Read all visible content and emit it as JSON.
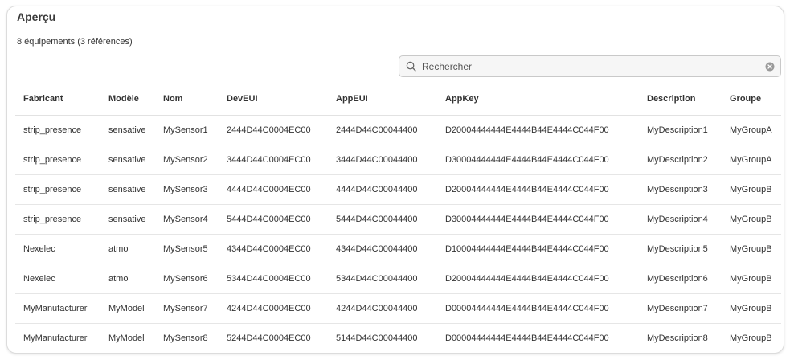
{
  "panel": {
    "title": "Aperçu",
    "summary": "8 équipements (3 références)"
  },
  "search": {
    "placeholder": "Rechercher",
    "value": "",
    "icon": "search-icon",
    "clear_icon": "clear-icon"
  },
  "table": {
    "columns": [
      "Fabricant",
      "Modèle",
      "Nom",
      "DevEUI",
      "AppEUI",
      "AppKey",
      "Description",
      "Groupe"
    ],
    "rows": [
      [
        "strip_presence",
        "sensative",
        "MySensor1",
        "2444D44C0004EC00",
        "2444D44C00044400",
        "D20004444444E4444B44E4444C044F00",
        "MyDescription1",
        "MyGroupA"
      ],
      [
        "strip_presence",
        "sensative",
        "MySensor2",
        "3444D44C0004EC00",
        "3444D44C00044400",
        "D30004444444E4444B44E4444C044F00",
        "MyDescription2",
        "MyGroupA"
      ],
      [
        "strip_presence",
        "sensative",
        "MySensor3",
        "4444D44C0004EC00",
        "4444D44C00044400",
        "D20004444444E4444B44E4444C044F00",
        "MyDescription3",
        "MyGroupB"
      ],
      [
        "strip_presence",
        "sensative",
        "MySensor4",
        "5444D44C0004EC00",
        "5444D44C00044400",
        "D30004444444E4444B44E4444C044F00",
        "MyDescription4",
        "MyGroupB"
      ],
      [
        "Nexelec",
        "atmo",
        "MySensor5",
        "4344D44C0004EC00",
        "4344D44C00044400",
        "D10004444444E4444B44E4444C044F00",
        "MyDescription5",
        "MyGroupB"
      ],
      [
        "Nexelec",
        "atmo",
        "MySensor6",
        "5344D44C0004EC00",
        "5344D44C00044400",
        "D20004444444E4444B44E4444C044F00",
        "MyDescription6",
        "MyGroupB"
      ],
      [
        "MyManufacturer",
        "MyModel",
        "MySensor7",
        "4244D44C0004EC00",
        "4244D44C00044400",
        "D00004444444E4444B44E4444C044F00",
        "MyDescription7",
        "MyGroupB"
      ],
      [
        "MyManufacturer",
        "MyModel",
        "MySensor8",
        "5244D44C0004EC00",
        "5144D44C00044400",
        "D00004444444E4444B44E4444C044F00",
        "MyDescription8",
        "MyGroupB"
      ]
    ]
  }
}
